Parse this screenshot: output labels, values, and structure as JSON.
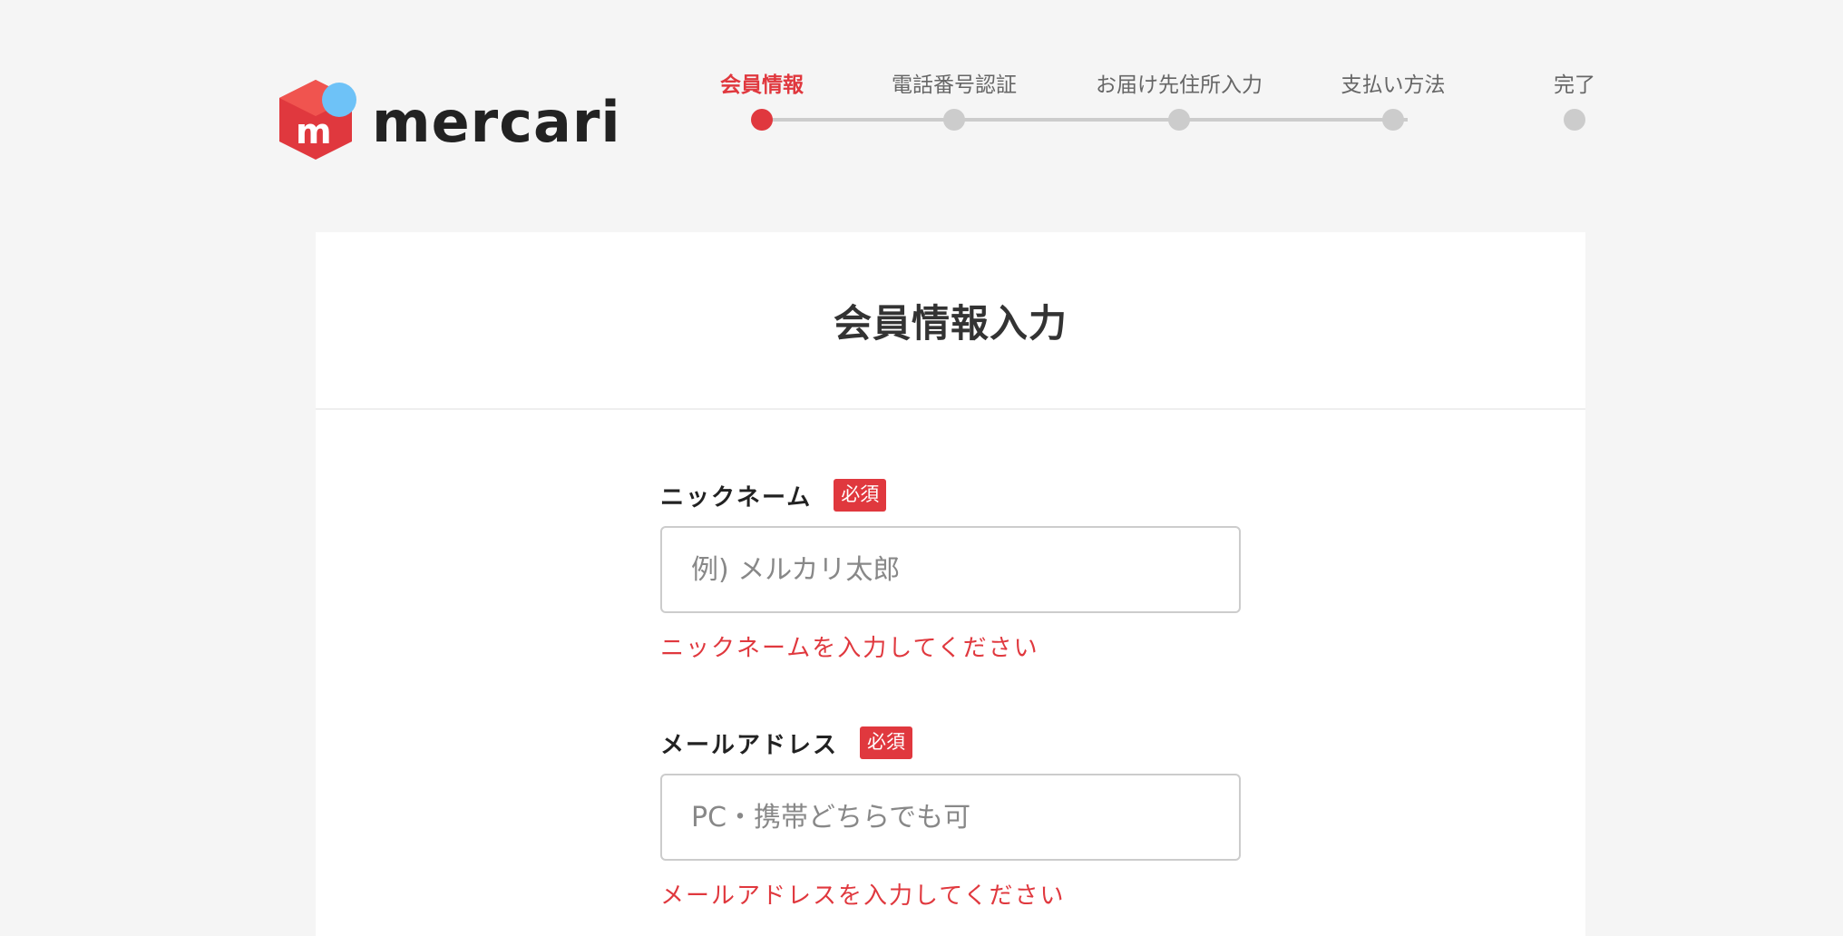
{
  "logo": {
    "text": "mercari",
    "mark_letter": "m",
    "colors": {
      "red": "#e0383e",
      "blue": "#6ec2f7"
    }
  },
  "stepper": {
    "steps": [
      {
        "label": "会員情報",
        "active": true
      },
      {
        "label": "電話番号認証",
        "active": false
      },
      {
        "label": "お届け先住所入力",
        "active": false
      },
      {
        "label": "支払い方法",
        "active": false
      },
      {
        "label": "完了",
        "active": false
      }
    ]
  },
  "card": {
    "title": "会員情報入力"
  },
  "form": {
    "nickname": {
      "label": "ニックネーム",
      "badge": "必須",
      "placeholder": "例) メルカリ太郎",
      "value": "",
      "error": "ニックネームを入力してください"
    },
    "email": {
      "label": "メールアドレス",
      "badge": "必須",
      "placeholder": "PC・携帯どちらでも可",
      "value": "",
      "error": "メールアドレスを入力してください"
    }
  },
  "colors": {
    "accent": "#e0383e",
    "background": "#f5f5f5",
    "inactive_step": "#cccccc"
  }
}
